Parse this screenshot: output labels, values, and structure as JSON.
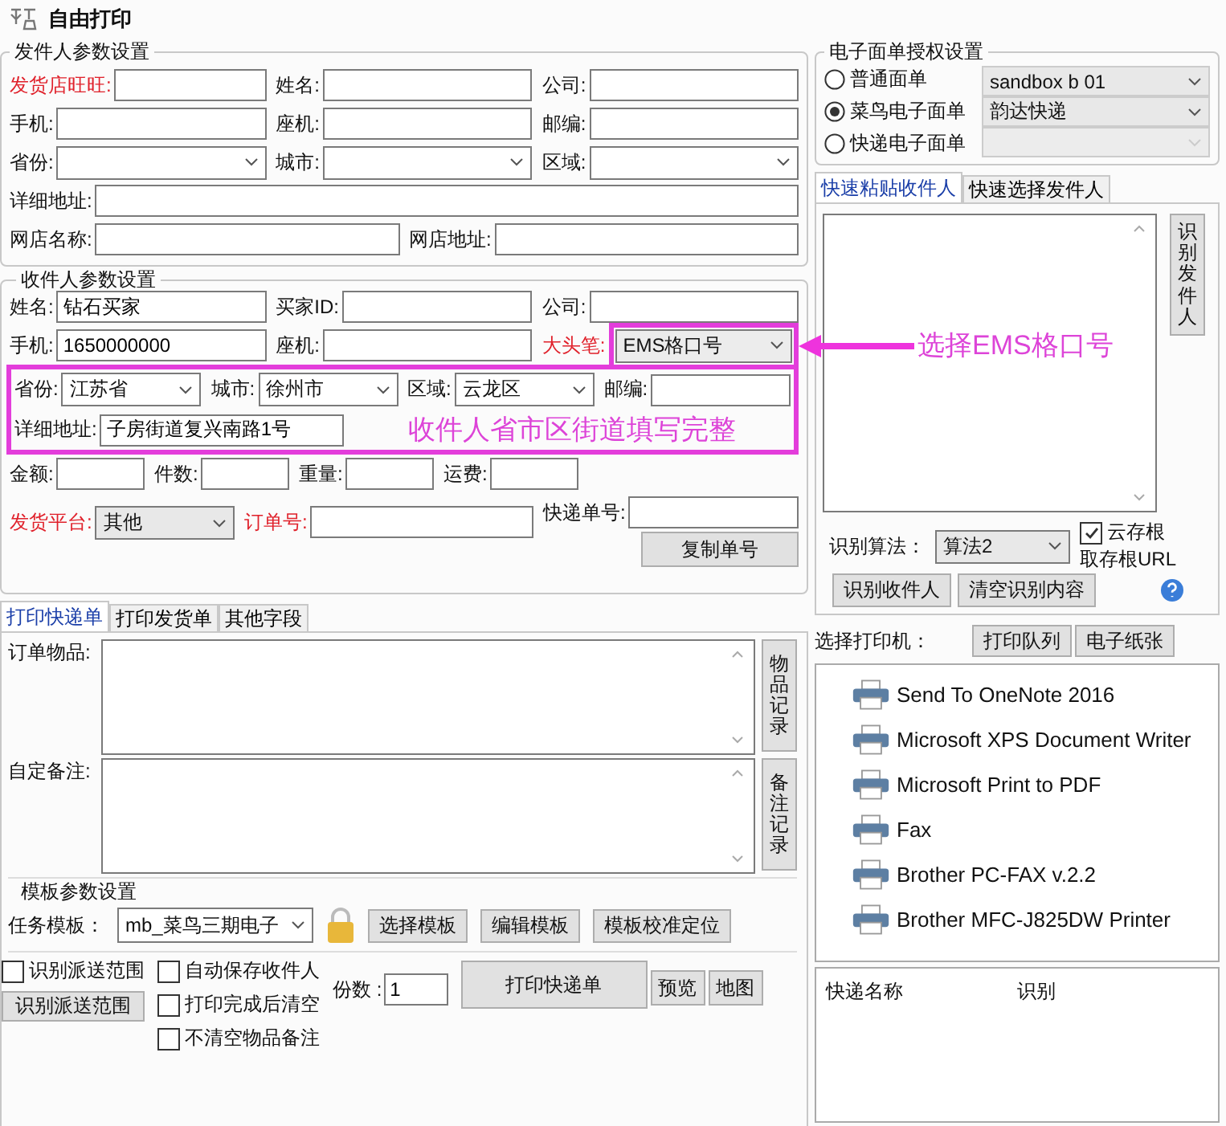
{
  "window": {
    "title": "自由打印"
  },
  "sender": {
    "title": "发件人参数设置",
    "rows": [
      {
        "fields": [
          {
            "label": "发货店旺旺:",
            "kind": "input",
            "required": true
          },
          {
            "label": "姓名:",
            "kind": "input",
            "required": false
          },
          {
            "label": "公司:",
            "kind": "input",
            "required": false
          }
        ]
      },
      {
        "fields": [
          {
            "label": "手机:",
            "kind": "input",
            "required": false
          },
          {
            "label": "座机:",
            "kind": "input",
            "required": false
          },
          {
            "label": "邮编:",
            "kind": "input",
            "required": false
          }
        ]
      },
      {
        "fields": [
          {
            "label": "省份:",
            "kind": "select",
            "required": false
          },
          {
            "label": "城市:",
            "kind": "select",
            "required": false
          },
          {
            "label": "区域:",
            "kind": "select",
            "required": false
          }
        ]
      },
      {
        "fields": [
          {
            "label": "详细地址:",
            "kind": "input",
            "required": false
          }
        ]
      },
      {
        "fields": [
          {
            "label": "网店名称:",
            "kind": "input",
            "required": false
          },
          {
            "label": "网店地址:",
            "kind": "input",
            "required": false
          }
        ]
      }
    ]
  },
  "receiver": {
    "title": "收件人参数设置",
    "rows": [
      {
        "fields": [
          {
            "label": "姓名:",
            "kind": "input",
            "value": "钻石买家",
            "required": false
          },
          {
            "label": "买家ID:",
            "kind": "input",
            "required": false
          },
          {
            "label": "公司:",
            "kind": "input",
            "required": false
          }
        ]
      },
      {
        "fields": [
          {
            "label": "手机:",
            "kind": "input",
            "value": "1650000000",
            "required": false
          },
          {
            "label": "座机:",
            "kind": "input",
            "required": false
          },
          {
            "label": "大头笔:",
            "kind": "select",
            "value": "EMS格口号",
            "required": true,
            "callout": "选择EMS格口号"
          }
        ]
      }
    ],
    "highlight": {
      "note": "收件人省市区街道填写完整",
      "rows": [
        {
          "fields": [
            {
              "label": "省份:",
              "kind": "select",
              "value": "江苏省",
              "required": false
            },
            {
              "label": "城市:",
              "kind": "select",
              "value": "徐州市",
              "required": false
            },
            {
              "label": "区域:",
              "kind": "select",
              "value": "云龙区",
              "required": false
            },
            {
              "label": "邮编:",
              "kind": "input",
              "required": false
            }
          ]
        },
        {
          "fields": [
            {
              "label": "详细地址:",
              "kind": "input",
              "value": "子房街道复兴南路1号",
              "required": false
            }
          ]
        }
      ]
    },
    "rows_after": [
      {
        "fields": [
          {
            "label": "金额:",
            "kind": "input",
            "required": false
          },
          {
            "label": "件数:",
            "kind": "input",
            "required": false
          },
          {
            "label": "重量:",
            "kind": "input",
            "required": false
          },
          {
            "label": "运费:",
            "kind": "input",
            "required": false
          }
        ]
      },
      {
        "fields": [
          {
            "label": "发货平台:",
            "kind": "select",
            "value": "其他",
            "required": true
          },
          {
            "label": "订单号:",
            "kind": "input",
            "required": true
          }
        ]
      }
    ],
    "tracking": {
      "label": "快递单号:",
      "button": "复制单号"
    }
  },
  "tabs": [
    {
      "label": "打印快递单",
      "selected": true
    },
    {
      "label": "打印发货单",
      "selected": false
    },
    {
      "label": "其他字段",
      "selected": false
    }
  ],
  "notes": [
    {
      "label": "订单物品:",
      "button": "物品记录"
    },
    {
      "label": "自定备注:",
      "button": "备注记录"
    }
  ],
  "template": {
    "title": "模板参数设置",
    "label": "任务模板：",
    "value": "mb_菜鸟三期电子",
    "buttons": [
      "选择模板",
      "编辑模板",
      "模板校准定位"
    ]
  },
  "options": {
    "scope_check": {
      "label": "识别派送范围",
      "checked": false
    },
    "scope_button": "识别派送范围",
    "checks": [
      {
        "label": "自动保存收件人",
        "checked": false
      },
      {
        "label": "打印完成后清空",
        "checked": false
      },
      {
        "label": "不清空物品备注",
        "checked": false
      }
    ],
    "copies_label": "份数 :",
    "copies": "1",
    "print_button": "打印快递单",
    "buttons": [
      "预览",
      "地图"
    ]
  },
  "auth": {
    "title": "电子面单授权设置",
    "radios": [
      {
        "label": "普通面单",
        "selected": false
      },
      {
        "label": "菜鸟电子面单",
        "selected": true
      },
      {
        "label": "快递电子面单",
        "selected": false
      }
    ],
    "selects": [
      {
        "value": "sandbox b 01",
        "disabled": false
      },
      {
        "value": "韵达快递",
        "disabled": false
      },
      {
        "disabled": true
      }
    ]
  },
  "paste_tabs": [
    {
      "label": "快速粘贴收件人",
      "selected": true
    },
    {
      "label": "快速选择发件人",
      "selected": false
    }
  ],
  "paste": {
    "side_button": "识别发件人",
    "algo_label": "识别算法：",
    "algo": "算法2",
    "cloud": {
      "label": "云存根",
      "checked": true
    },
    "url_label": "取存根URL",
    "buttons": [
      "识别收件人",
      "清空识别内容"
    ]
  },
  "printers": {
    "label": "选择打印机：",
    "buttons": [
      "打印队列",
      "电子纸张"
    ],
    "items": [
      "Send To OneNote 2016",
      "Microsoft XPS Document Writer",
      "Microsoft Print to PDF",
      "Fax",
      "Brother PC-FAX v.2.2",
      "Brother MFC-J825DW Printer"
    ]
  },
  "carriers": {
    "columns": [
      "快递名称",
      "识别"
    ]
  }
}
